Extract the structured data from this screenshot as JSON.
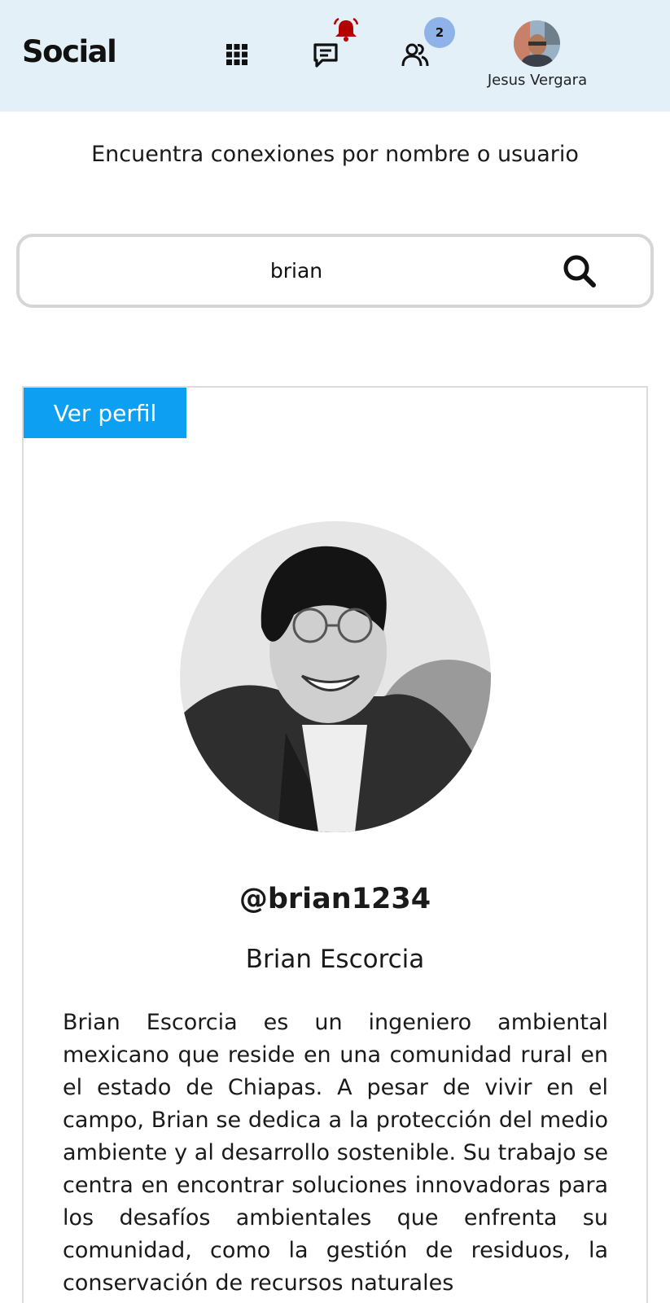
{
  "header": {
    "logo": "Social",
    "notification_badge": "2",
    "user_name": "Jesus Vergara",
    "icons": [
      "apps-grid-icon",
      "chat-icon",
      "bell-icon",
      "friends-icon"
    ],
    "bell_color": "#b30000",
    "background": "#e3f0f7"
  },
  "search": {
    "heading": "Encuentra conexiones por nombre o usuario",
    "query": "brian",
    "icon": "search-icon"
  },
  "result": {
    "view_profile_label": "Ver perfil",
    "handle": "@brian1234",
    "full_name": "Brian Escorcia",
    "bio": "Brian Escorcia es un ingeniero ambiental mexicano que reside en una comunidad rural en el estado de Chiapas. A pesar de vivir en el campo, Brian se dedica a la protección del medio ambiente y al desarrollo sostenible. Su trabajo se centra en encontrar soluciones innovadoras para los desafíos ambientales que enfrenta su comunidad, como la gestión de residuos, la conservación de recursos naturales",
    "accent_color": "#0da0f2"
  }
}
